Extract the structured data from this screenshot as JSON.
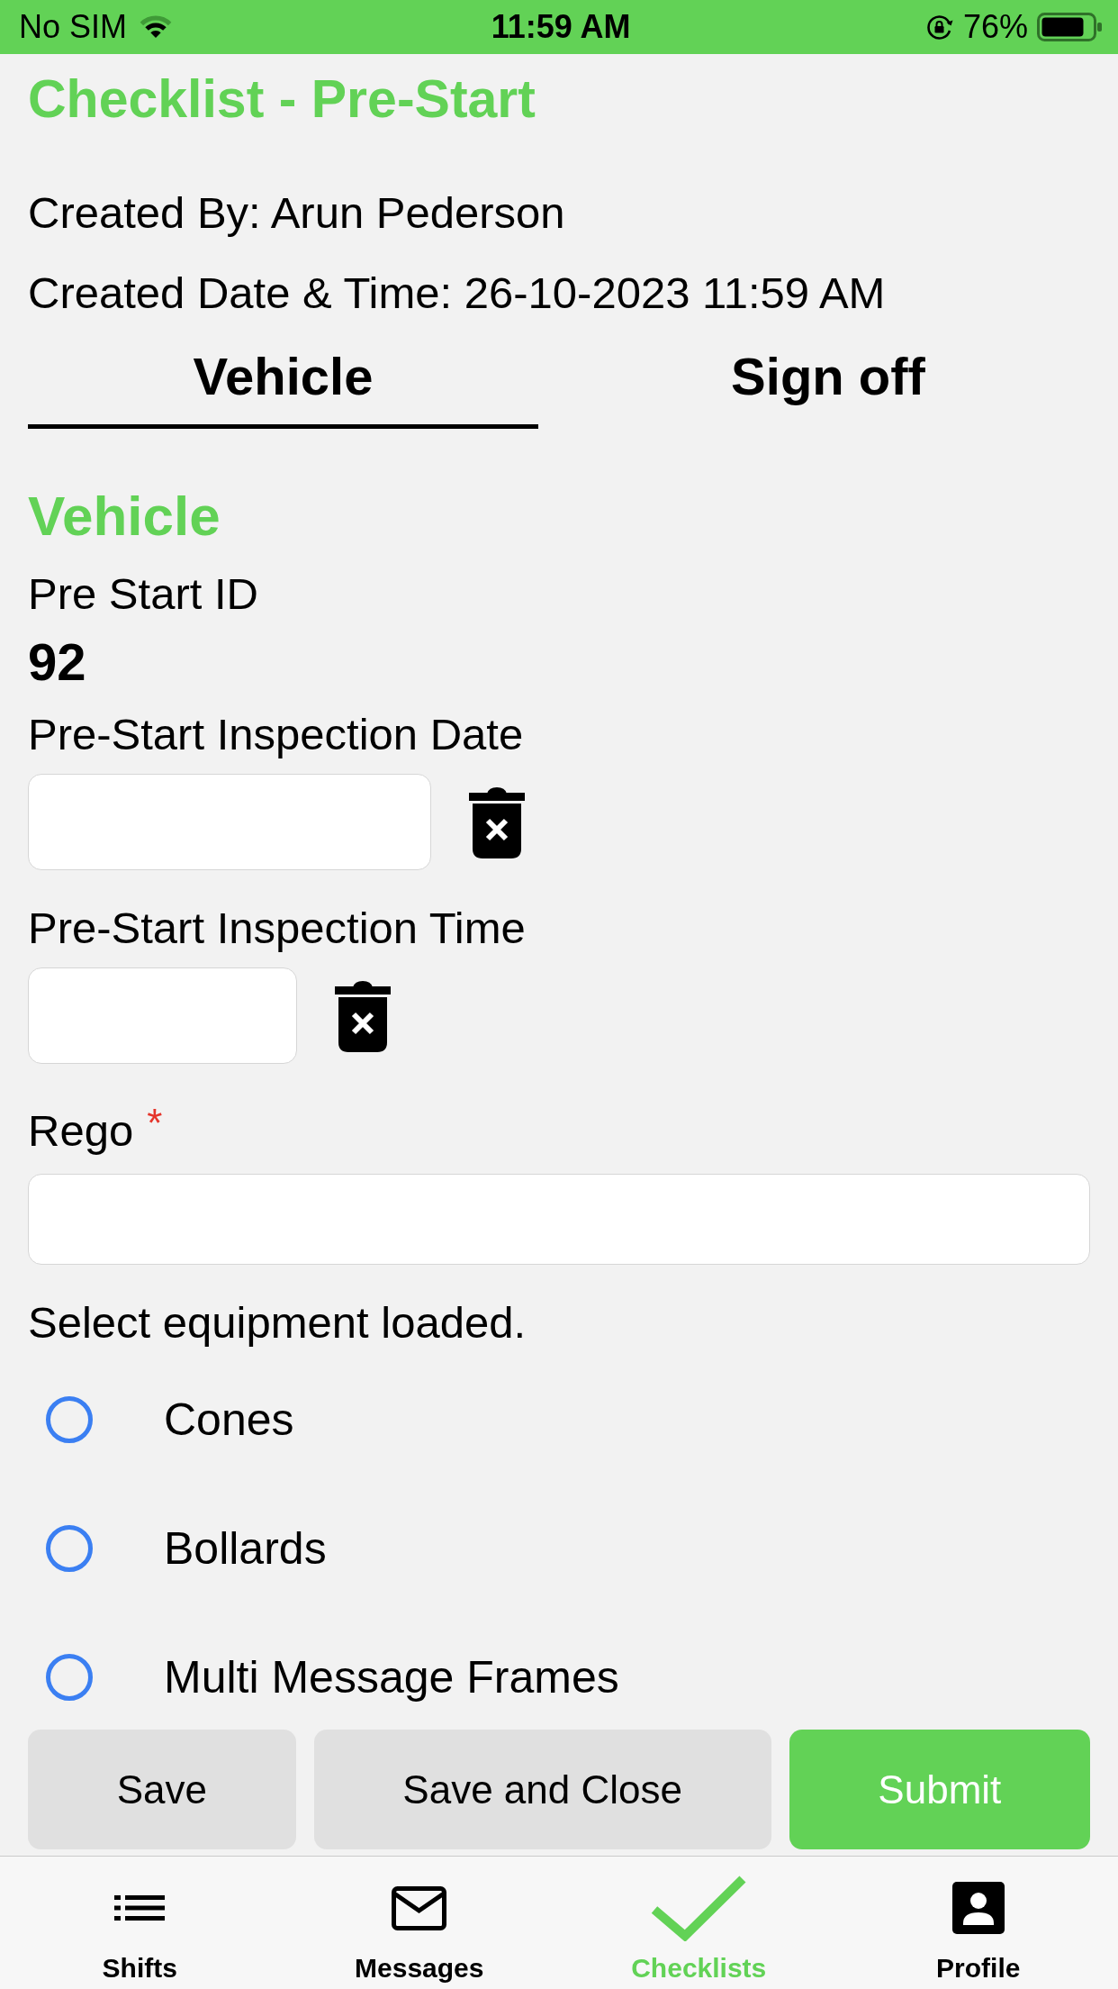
{
  "status_bar": {
    "carrier": "No SIM",
    "time": "11:59 AM",
    "battery": "76%"
  },
  "header": {
    "title": "Checklist - Pre-Start",
    "created_by": "Created By: Arun Pederson",
    "created_at": "Created Date & Time: 26-10-2023 11:59 AM"
  },
  "tabs": [
    {
      "label": "Vehicle",
      "selected": true
    },
    {
      "label": "Sign off",
      "selected": false
    }
  ],
  "section": {
    "title": "Vehicle",
    "fields": [
      {
        "kind": "readonly",
        "label": "Pre Start ID",
        "value": "92"
      },
      {
        "kind": "date",
        "label": "Pre-Start Inspection Date"
      },
      {
        "kind": "time",
        "label": "Pre-Start Inspection Time"
      },
      {
        "kind": "text",
        "label": "Rego",
        "required_mark": "*"
      },
      {
        "kind": "radio",
        "label": "Select equipment loaded.",
        "options": [
          {
            "label": "Cones",
            "selected": false
          },
          {
            "label": "Bollards",
            "selected": false
          },
          {
            "label": "Multi Message Frames",
            "selected": false
          }
        ]
      }
    ]
  },
  "actions": [
    {
      "label": "Save",
      "kind": "secondary"
    },
    {
      "label": "Save and Close",
      "kind": "secondary"
    },
    {
      "label": "Submit",
      "kind": "primary"
    }
  ],
  "tab_bar": [
    {
      "label": "Shifts",
      "selected": false
    },
    {
      "label": "Messages",
      "selected": false
    },
    {
      "label": "Checklists",
      "selected": true
    },
    {
      "label": "Profile",
      "selected": false
    }
  ]
}
